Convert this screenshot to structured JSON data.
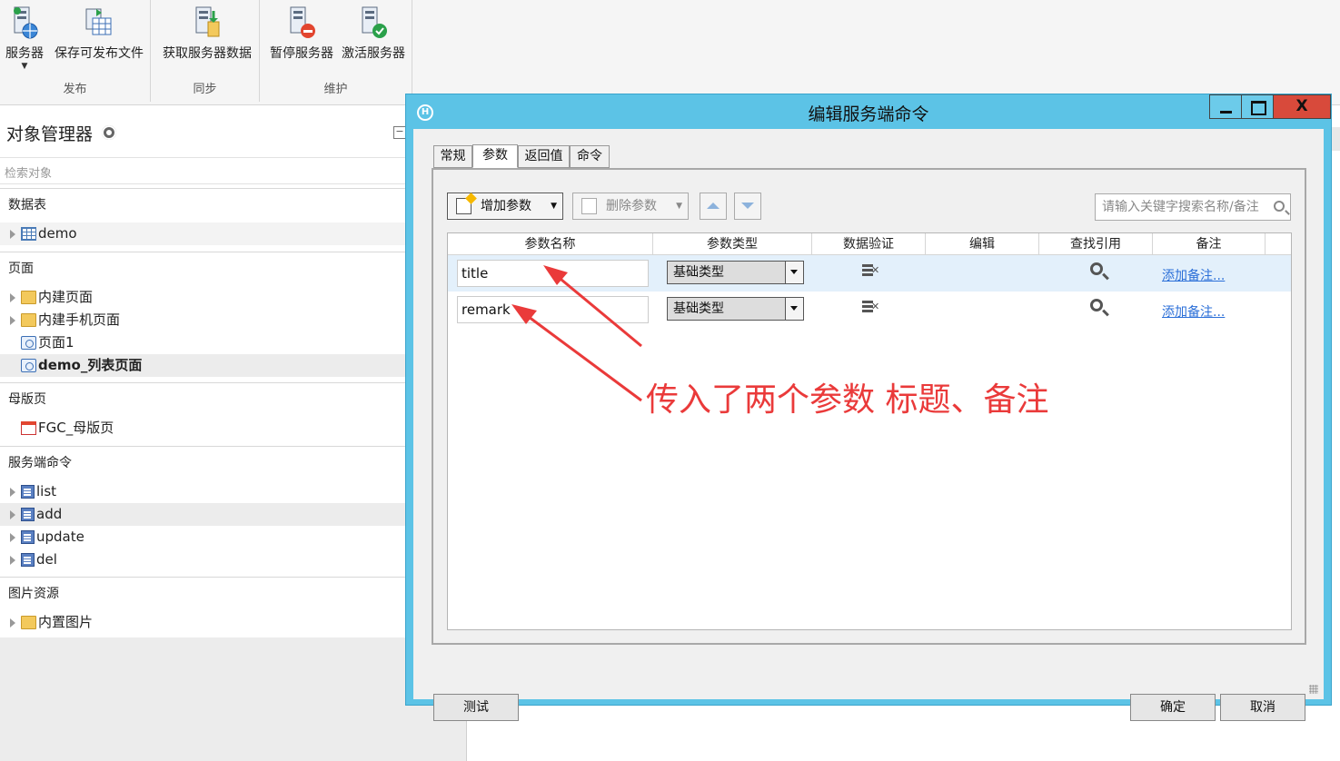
{
  "ribbon": {
    "groups": [
      {
        "label": "发布",
        "buttons": [
          "服务器",
          "保存可发布文件"
        ]
      },
      {
        "label": "同步",
        "buttons": [
          "获取服务器数据"
        ]
      },
      {
        "label": "维护",
        "buttons": [
          "暂停服务器",
          "激活服务器"
        ]
      }
    ]
  },
  "object_manager": {
    "title": "对象管理器",
    "search_placeholder": "检索对象",
    "collapse_glyph": "−",
    "sections": [
      {
        "label": "数据表",
        "items": [
          {
            "label": "demo",
            "icon": "table-icon"
          }
        ]
      },
      {
        "label": "页面",
        "items": [
          {
            "label": "内建页面",
            "icon": "folder-icon"
          },
          {
            "label": "内建手机页面",
            "icon": "folder-icon"
          },
          {
            "label": "页面1",
            "icon": "page-icon"
          },
          {
            "label": "demo_列表页面",
            "icon": "page-icon",
            "bold": true
          }
        ]
      },
      {
        "label": "母版页",
        "items": [
          {
            "label": "FGC_母版页",
            "icon": "master-page-icon"
          }
        ]
      },
      {
        "label": "服务端命令",
        "items": [
          {
            "label": "list",
            "icon": "server-command-icon"
          },
          {
            "label": "add",
            "icon": "server-command-icon"
          },
          {
            "label": "update",
            "icon": "server-command-icon"
          },
          {
            "label": "del",
            "icon": "server-command-icon"
          }
        ]
      },
      {
        "label": "图片资源",
        "items": [
          {
            "label": "内置图片",
            "icon": "folder-icon"
          }
        ]
      }
    ]
  },
  "dialog": {
    "title": "编辑服务端命令",
    "logo": "H",
    "close_glyph": "X",
    "tabs": [
      "常规",
      "参数",
      "返回值",
      "命令"
    ],
    "active_tab": "参数",
    "toolbar": {
      "add_label": "增加参数",
      "delete_label": "删除参数",
      "search_placeholder": "请输入关键字搜索名称/备注"
    },
    "columns": [
      "参数名称",
      "参数类型",
      "数据验证",
      "编辑",
      "查找引用",
      "备注"
    ],
    "rows": [
      {
        "name": "title",
        "type": "基础类型",
        "note": "添加备注..."
      },
      {
        "name": "remark",
        "type": "基础类型",
        "note": "添加备注..."
      }
    ],
    "test_button": "测试",
    "ok_button": "确定",
    "cancel_button": "取消"
  },
  "annotation": {
    "text": "传入了两个参数 标题、备注",
    "color": "#ea3a3a"
  },
  "colors": {
    "dialog_frame": "#5cc3e6",
    "close_button": "#d84a3b",
    "selected_row": "#e3f0fb",
    "link": "#2b6fd8"
  }
}
